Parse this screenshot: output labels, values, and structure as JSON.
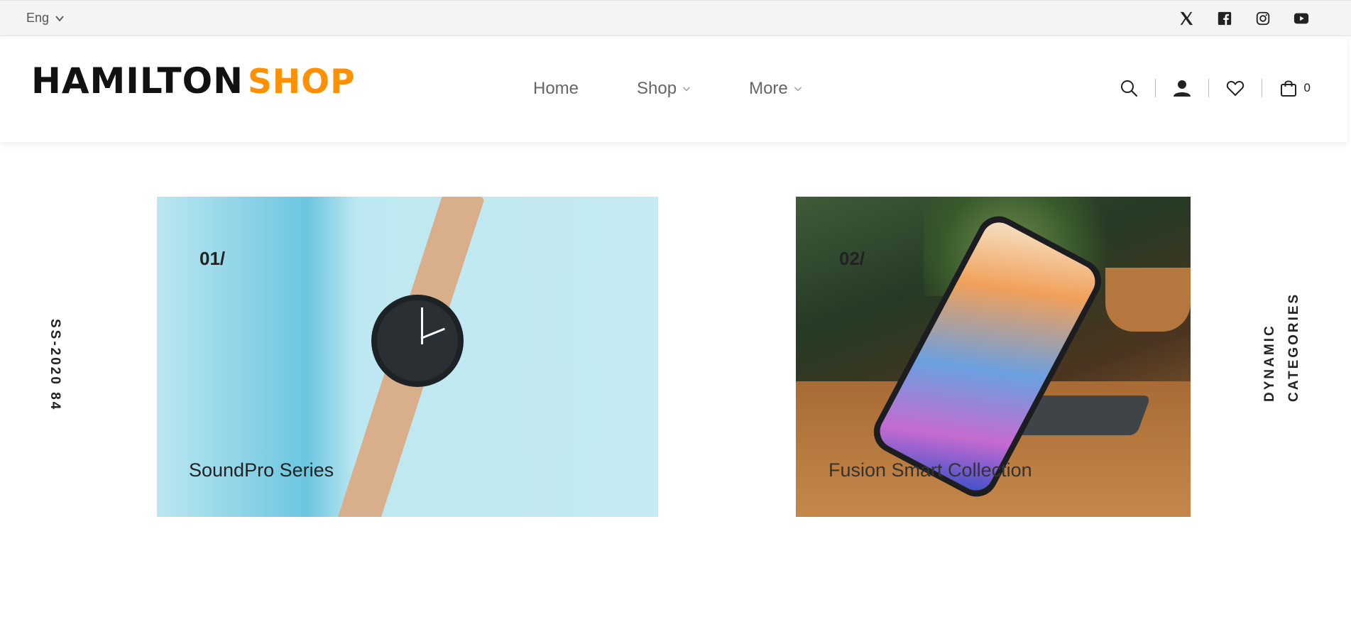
{
  "topbar": {
    "language": "Eng",
    "socials": [
      "x-icon",
      "facebook-icon",
      "instagram-icon",
      "youtube-icon"
    ]
  },
  "header": {
    "logo": {
      "dark": "HAMILTON",
      "accent": "SHOP"
    },
    "nav": [
      {
        "label": "Home",
        "dropdown": false
      },
      {
        "label": "Shop",
        "dropdown": true
      },
      {
        "label": "More",
        "dropdown": true
      }
    ],
    "actions": [
      "search-icon",
      "user-icon",
      "heart-icon",
      "bag-icon"
    ],
    "cart_count": "0"
  },
  "hero": {
    "left_vertical": "SS-2020 84",
    "right_vertical": "DYNAMIC CATEGORIES",
    "cards": [
      {
        "number": "01/",
        "title": "SoundPro Series"
      },
      {
        "number": "02/",
        "title": "Fusion Smart Collection"
      }
    ]
  },
  "colors": {
    "accent": "#ff9000",
    "topbar_bg": "#f4f4f4",
    "text": "#222222"
  }
}
